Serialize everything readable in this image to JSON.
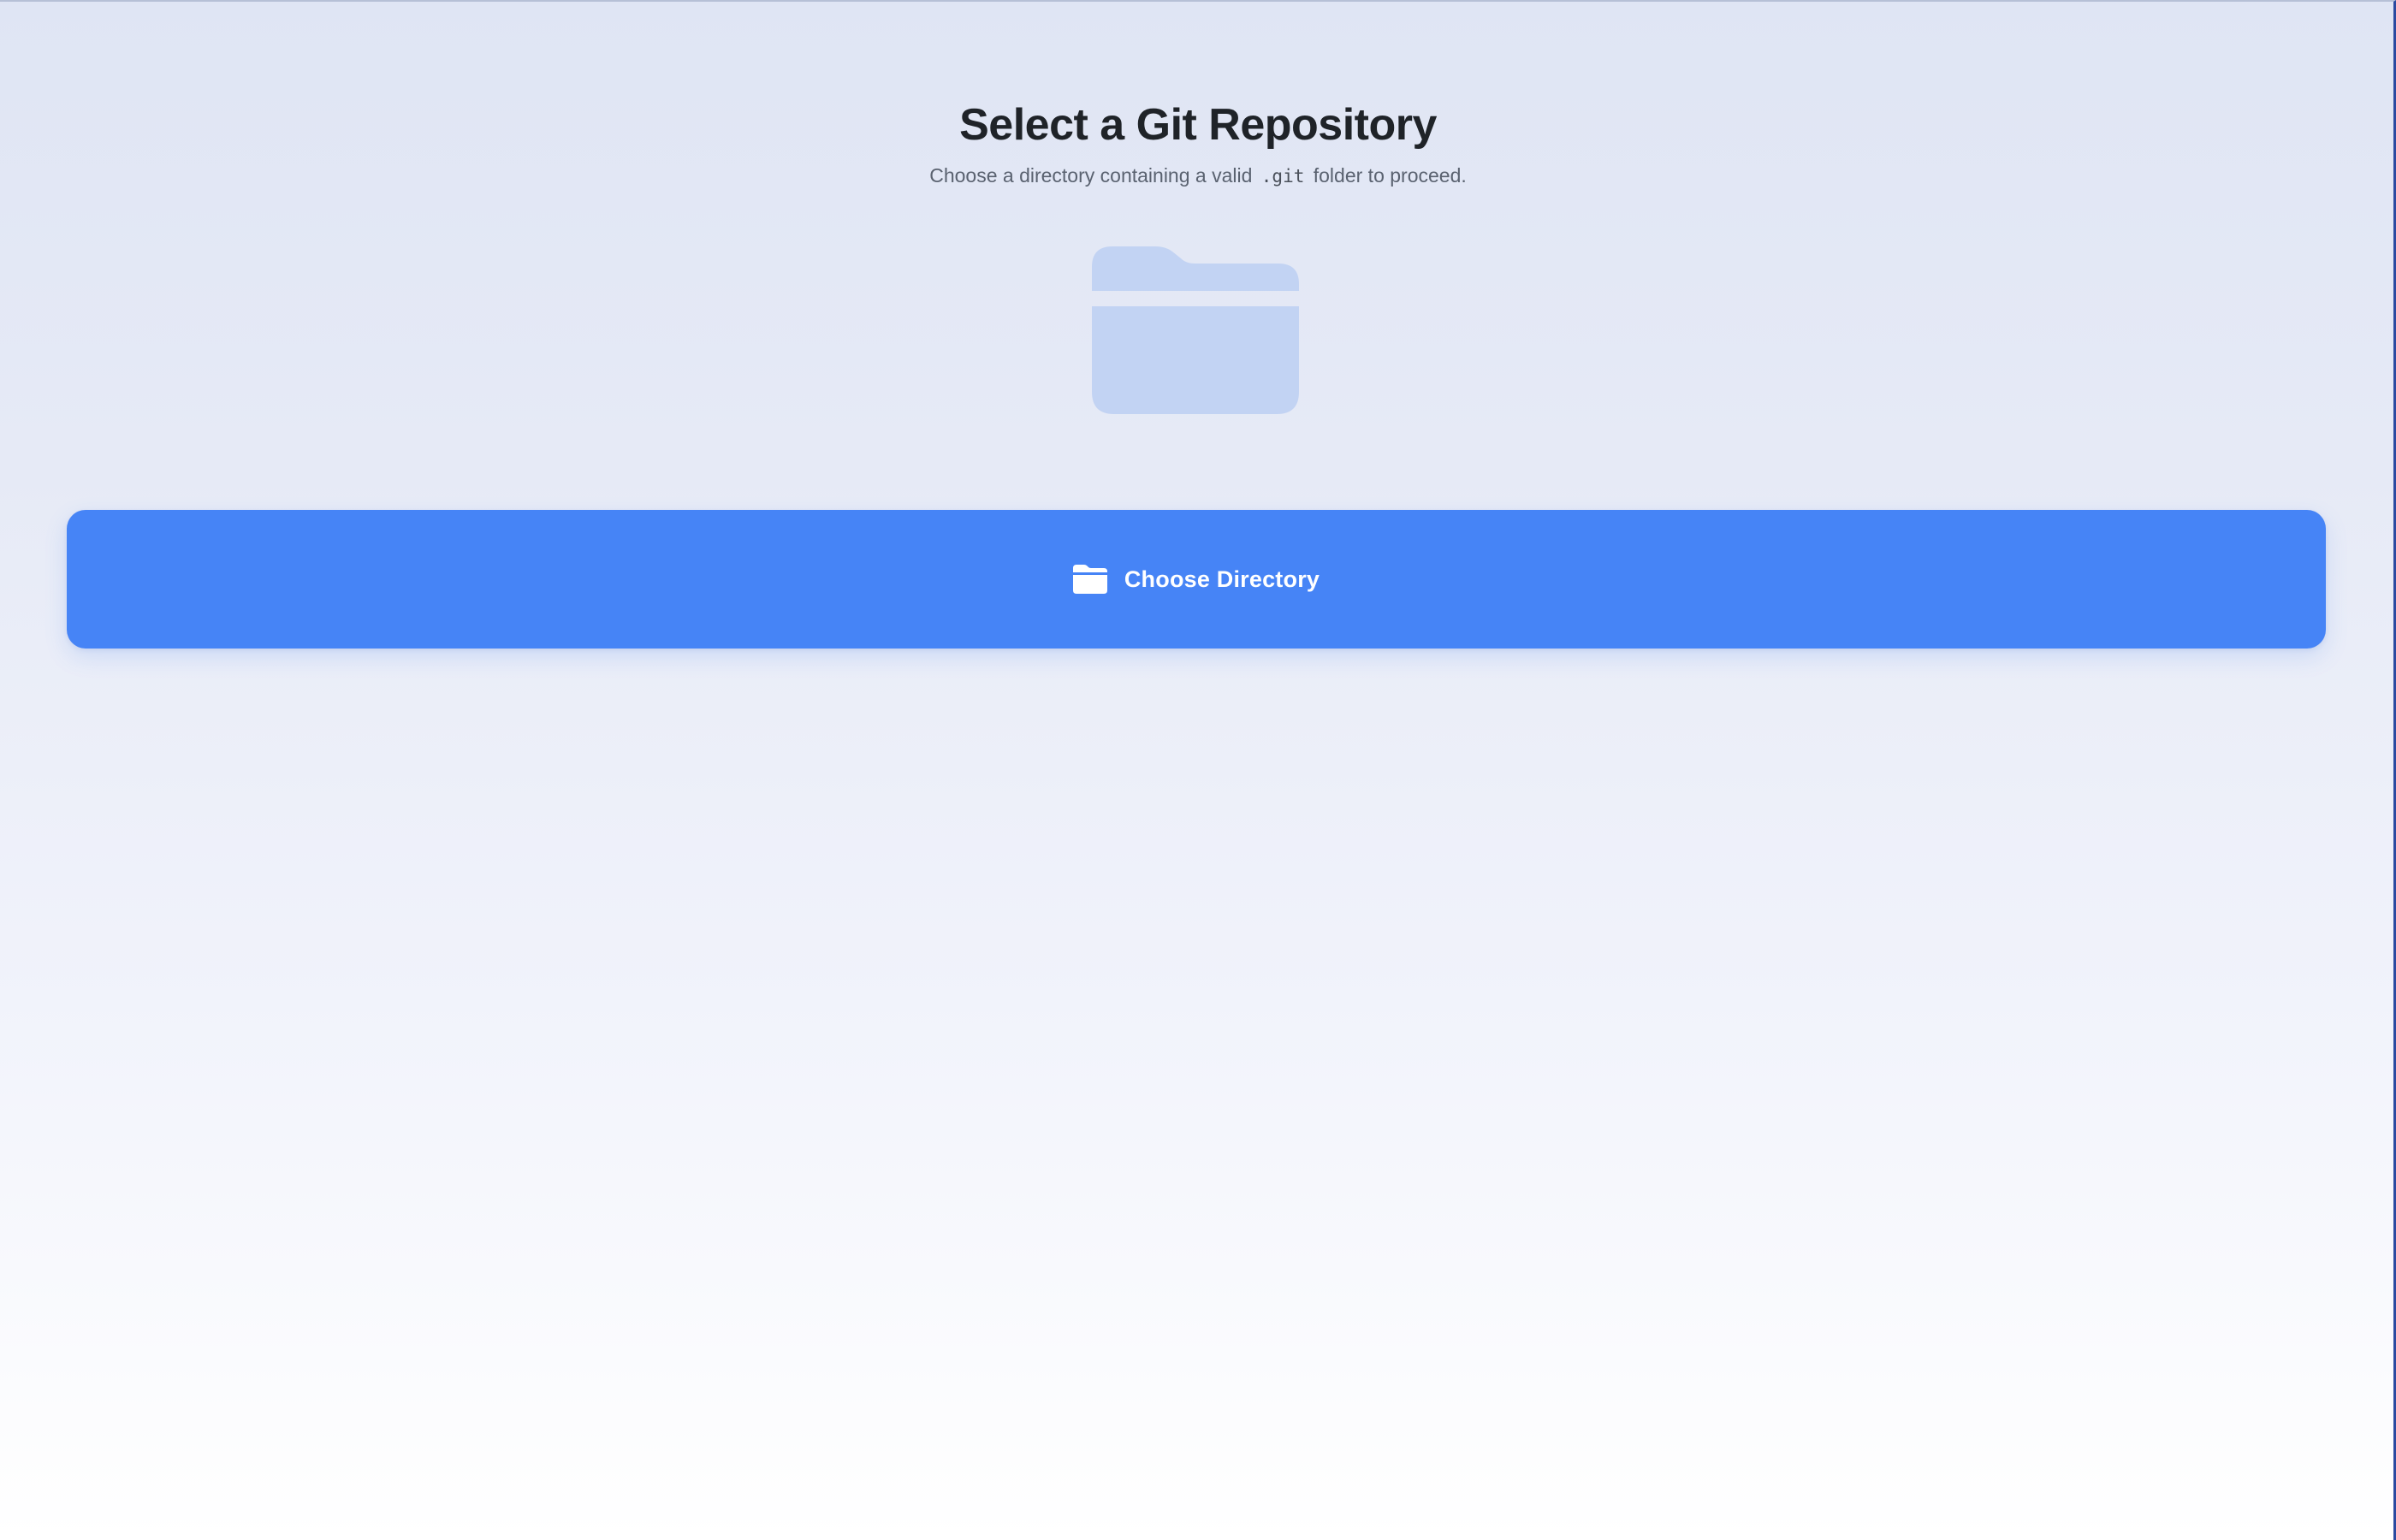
{
  "page": {
    "title": "Select a Git Repository",
    "subtitle_before": "Choose a directory containing a valid",
    "subtitle_code": ".git",
    "subtitle_after": "folder to proceed."
  },
  "hero": {
    "icon": "folder-icon",
    "icon_color": "#c2d3f3"
  },
  "choose_button": {
    "label": "Choose Directory",
    "icon": "folder-open-icon",
    "background": "#4684f6",
    "text_color": "#ffffff"
  }
}
